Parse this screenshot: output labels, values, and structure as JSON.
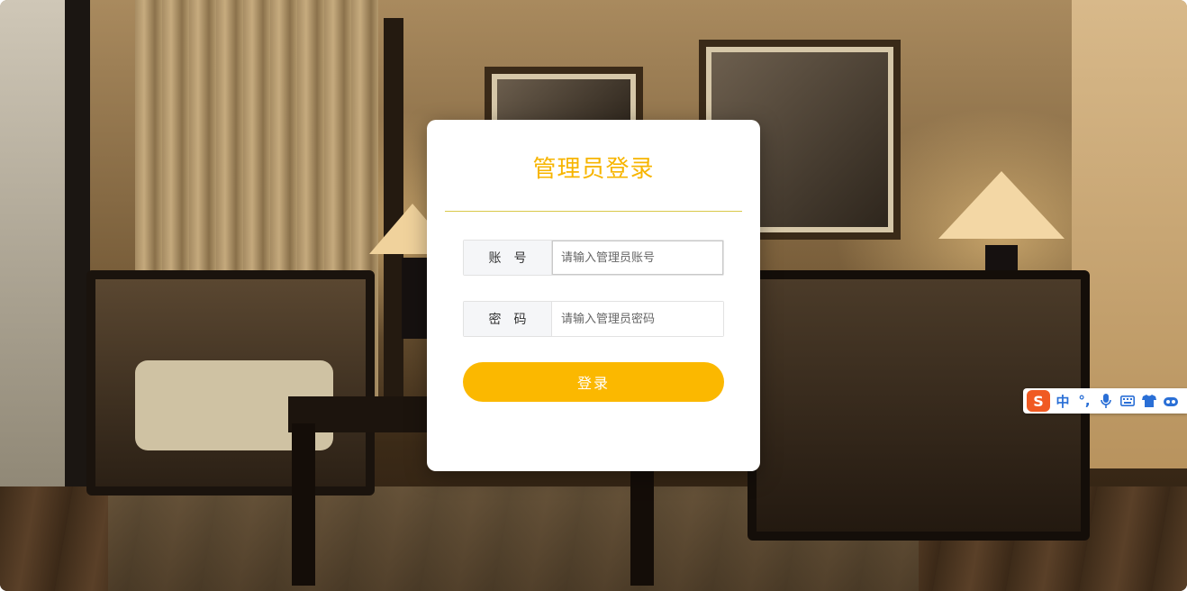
{
  "login": {
    "title": "管理员登录",
    "account_label": "账号",
    "account_placeholder": "请输入管理员账号",
    "password_label": "密码",
    "password_placeholder": "请输入管理员密码",
    "submit_label": "登录"
  },
  "ime_toolbar": {
    "logo": "S",
    "mode_label": "中",
    "punctuation_label": "°,",
    "icons": [
      "microphone-icon",
      "keyboard-icon",
      "skin-shirt-icon",
      "toolbox-icon"
    ]
  },
  "colors": {
    "accent": "#f7b500",
    "button": "#fbb800",
    "divider": "#d9c94a",
    "ime_logo": "#f05a22",
    "ime_icon": "#2a6fd6"
  }
}
